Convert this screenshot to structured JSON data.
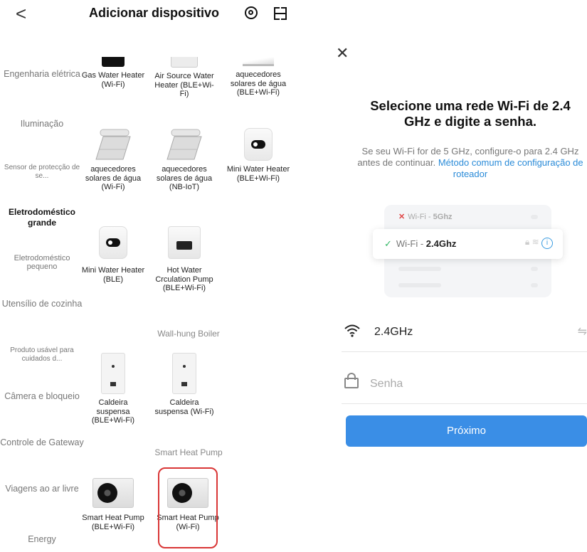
{
  "left": {
    "header": {
      "back": "<",
      "title": "Adicionar dispositivo"
    },
    "categories": [
      "Engenharia elétrica",
      "Iluminação",
      "Sensor de protecção de se...",
      "Eletrodoméstico grande",
      "Eletrodoméstico pequeno",
      "Utensílio de cozinha",
      "Produto usável para cuidados d...",
      "Câmera e bloqueio",
      "Controle de Gateway",
      "Viagens ao ar livre",
      "Energy"
    ],
    "active_category": "Eletrodoméstico grande",
    "devices": {
      "gas_water_heater": "Gas Water Heater (Wi-Fi)",
      "air_source_water_heater": "Air Source Water Heater (BLE+Wi-Fi)",
      "solar_ble_wifi": "aquecedores solares de água (BLE+Wi-Fi)",
      "solar_wifi": "aquecedores solares de água (Wi-Fi)",
      "solar_nbiot": "aquecedores solares de água (NB-IoT)",
      "mini_water_heater_ble_wifi": "Mini Water Heater (BLE+Wi-Fi)",
      "mini_water_heater_ble": "Mini Water Heater (BLE)",
      "hot_water_circulation_pump": "Hot Water Crculation Pump (BLE+Wi-Fi)",
      "boiler_ble_wifi": "Caldeira suspensa (BLE+Wi-Fi)",
      "boiler_wifi": "Caldeira suspensa (Wi-Fi)",
      "heat_pump_ble_wifi": "Smart Heat Pump (BLE+Wi-Fi)",
      "heat_pump_wifi": "Smart Heat Pump (Wi-Fi)"
    },
    "sections": {
      "boiler": "Wall-hung Boiler",
      "heat_pump": "Smart Heat Pump"
    }
  },
  "right": {
    "close": "✕",
    "title": "Selecione uma rede Wi-Fi de 2.4 GHz e digite a senha.",
    "description": "Se seu Wi-Fi for de 5 GHz, configure-o para 2.4 GHz antes de continuar.",
    "link": "Método comum de configuração de roteador",
    "wifi_bad_prefix": "Wi-Fi - ",
    "wifi_bad_band": "5Ghz",
    "wifi_good_prefix": "Wi-Fi - ",
    "wifi_good_band": "2.4Ghz",
    "ssid_value": "2.4GHz",
    "password_placeholder": "Senha",
    "next_button": "Próximo"
  }
}
